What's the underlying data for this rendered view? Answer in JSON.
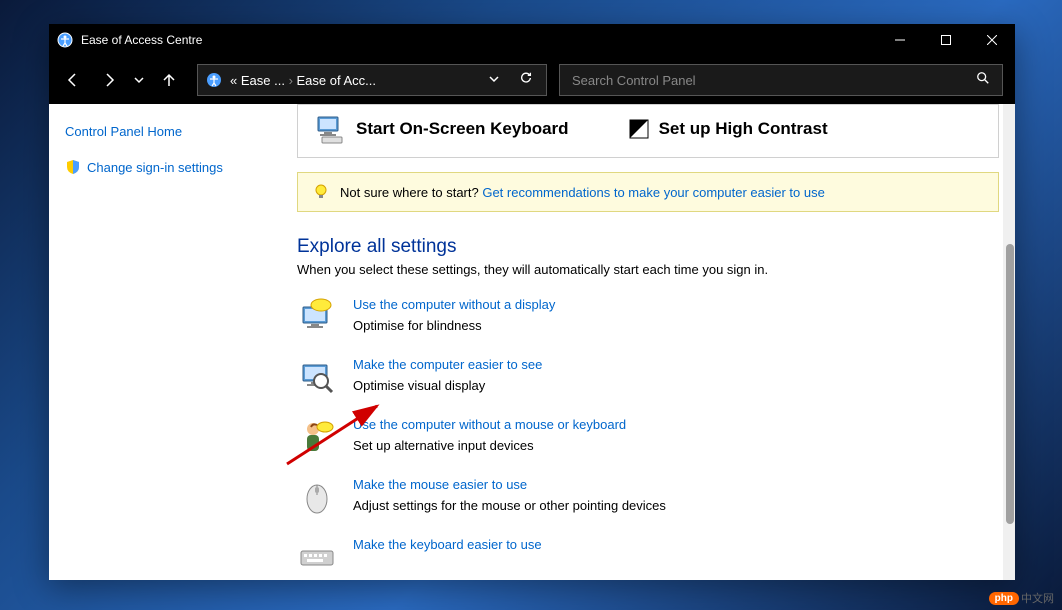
{
  "window": {
    "title": "Ease of Access Centre"
  },
  "breadcrumb": {
    "prefix": "«",
    "parent": "Ease ...",
    "current": "Ease of Acc..."
  },
  "search": {
    "placeholder": "Search Control Panel"
  },
  "sidebar": {
    "home_link": "Control Panel Home",
    "signin_link": "Change sign-in settings"
  },
  "quick_access": {
    "onscreen_keyboard": "Start On-Screen Keyboard",
    "high_contrast": "Set up High Contrast"
  },
  "info_banner": {
    "text": "Not sure where to start? ",
    "link": "Get recommendations to make your computer easier to use"
  },
  "explore": {
    "title": "Explore all settings",
    "desc": "When you select these settings, they will automatically start each time you sign in.",
    "items": [
      {
        "link": "Use the computer without a display",
        "sub": "Optimise for blindness"
      },
      {
        "link": "Make the computer easier to see",
        "sub": "Optimise visual display"
      },
      {
        "link": "Use the computer without a mouse or keyboard",
        "sub": "Set up alternative input devices"
      },
      {
        "link": "Make the mouse easier to use",
        "sub": "Adjust settings for the mouse or other pointing devices"
      },
      {
        "link": "Make the keyboard easier to use",
        "sub": ""
      }
    ]
  },
  "watermark": {
    "badge": "php",
    "text": "中文网"
  }
}
